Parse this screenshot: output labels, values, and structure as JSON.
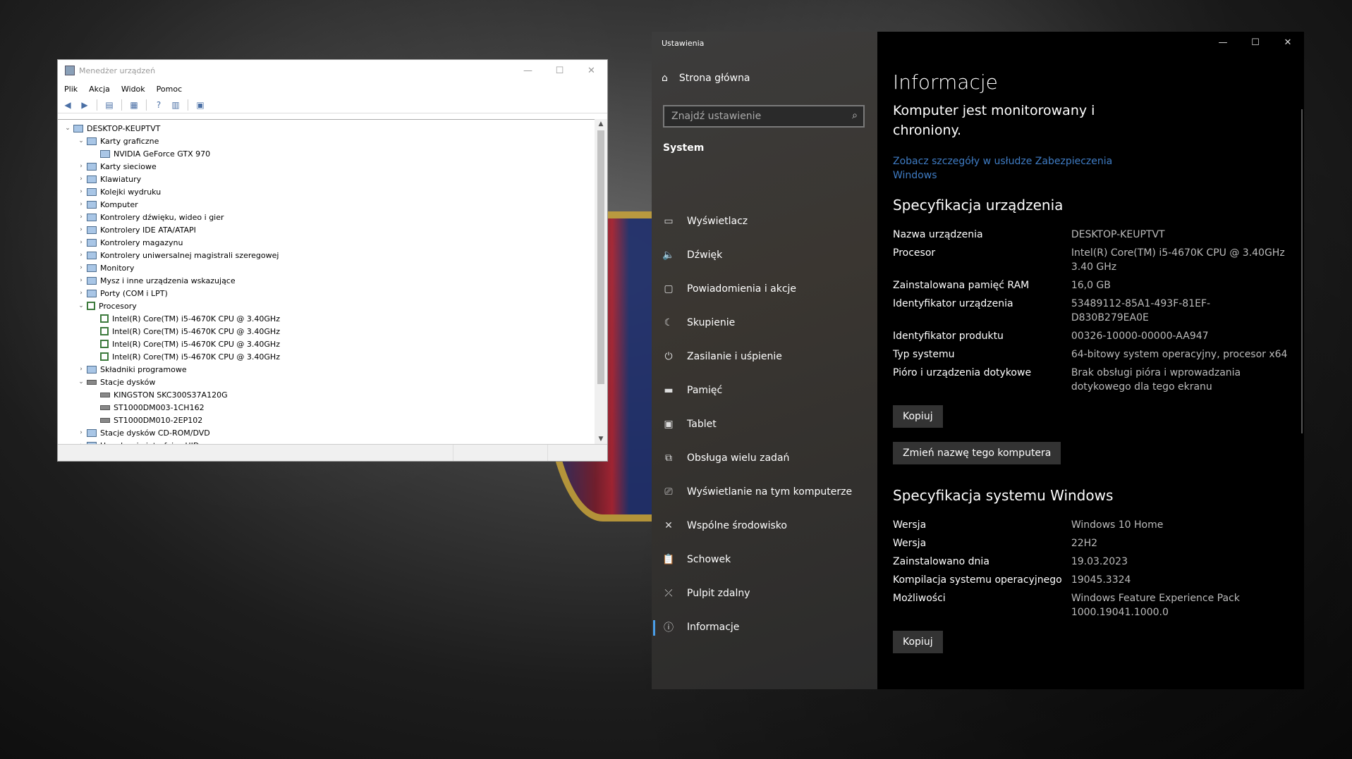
{
  "devmgr": {
    "title": "Menedżer urządzeń",
    "menu": [
      "Plik",
      "Akcja",
      "Widok",
      "Pomoc"
    ],
    "window_buttons": {
      "minimize": "—",
      "maximize": "☐",
      "close": "✕"
    },
    "tree": [
      {
        "arrow": "⌄",
        "text": "DESKTOP-KEUPTVT",
        "level": 0,
        "icon": "computer-icon"
      },
      {
        "arrow": "⌄",
        "text": "Karty graficzne",
        "level": 1,
        "icon": "display-adapter-icon"
      },
      {
        "arrow": "",
        "text": "NVIDIA GeForce GTX 970",
        "level": 2,
        "icon": "display-adapter-icon"
      },
      {
        "arrow": "›",
        "text": "Karty sieciowe",
        "level": 1,
        "icon": "network-adapter-icon"
      },
      {
        "arrow": "›",
        "text": "Klawiatury",
        "level": 1,
        "icon": "keyboard-icon"
      },
      {
        "arrow": "›",
        "text": "Kolejki wydruku",
        "level": 1,
        "icon": "printer-icon"
      },
      {
        "arrow": "›",
        "text": "Komputer",
        "level": 1,
        "icon": "monitor-icon"
      },
      {
        "arrow": "›",
        "text": "Kontrolery dźwięku, wideo i gier",
        "level": 1,
        "icon": "speaker-icon"
      },
      {
        "arrow": "›",
        "text": "Kontrolery IDE ATA/ATAPI",
        "level": 1,
        "icon": "ide-controller-icon"
      },
      {
        "arrow": "›",
        "text": "Kontrolery magazynu",
        "level": 1,
        "icon": "storage-controller-icon"
      },
      {
        "arrow": "›",
        "text": "Kontrolery uniwersalnej magistrali szeregowej",
        "level": 1,
        "icon": "usb-icon"
      },
      {
        "arrow": "›",
        "text": "Monitory",
        "level": 1,
        "icon": "monitor-icon"
      },
      {
        "arrow": "›",
        "text": "Mysz i inne urządzenia wskazujące",
        "level": 1,
        "icon": "mouse-icon"
      },
      {
        "arrow": "›",
        "text": "Porty (COM i LPT)",
        "level": 1,
        "icon": "port-icon"
      },
      {
        "arrow": "⌄",
        "text": "Procesory",
        "level": 1,
        "icon": "cpu-icon"
      },
      {
        "arrow": "",
        "text": "Intel(R) Core(TM) i5-4670K CPU @ 3.40GHz",
        "level": 2,
        "icon": "cpu-icon"
      },
      {
        "arrow": "",
        "text": "Intel(R) Core(TM) i5-4670K CPU @ 3.40GHz",
        "level": 2,
        "icon": "cpu-icon"
      },
      {
        "arrow": "",
        "text": "Intel(R) Core(TM) i5-4670K CPU @ 3.40GHz",
        "level": 2,
        "icon": "cpu-icon"
      },
      {
        "arrow": "",
        "text": "Intel(R) Core(TM) i5-4670K CPU @ 3.40GHz",
        "level": 2,
        "icon": "cpu-icon"
      },
      {
        "arrow": "›",
        "text": "Składniki programowe",
        "level": 1,
        "icon": "software-component-icon"
      },
      {
        "arrow": "⌄",
        "text": "Stacje dysków",
        "level": 1,
        "icon": "disk-icon"
      },
      {
        "arrow": "",
        "text": "KINGSTON SKC300S37A120G",
        "level": 2,
        "icon": "disk-icon"
      },
      {
        "arrow": "",
        "text": "ST1000DM003-1CH162",
        "level": 2,
        "icon": "disk-icon"
      },
      {
        "arrow": "",
        "text": "ST1000DM010-2EP102",
        "level": 2,
        "icon": "disk-icon"
      },
      {
        "arrow": "›",
        "text": "Stacje dysków CD-ROM/DVD",
        "level": 1,
        "icon": "cdrom-icon"
      },
      {
        "arrow": "›",
        "text": "Urządzenia interfejsu HID",
        "level": 1,
        "icon": "hid-icon"
      }
    ]
  },
  "settings": {
    "app_title": "Ustawienia",
    "home_label": "Strona główna",
    "search_placeholder": "Znajdź ustawienie",
    "section_label": "System",
    "nav_items": [
      {
        "label": "Wyświetlacz",
        "icon": "display-icon",
        "glyph": "▭"
      },
      {
        "label": "Dźwięk",
        "icon": "sound-icon",
        "glyph": "🔈"
      },
      {
        "label": "Powiadomienia i akcje",
        "icon": "notifications-icon",
        "glyph": "▢"
      },
      {
        "label": "Skupienie",
        "icon": "focus-moon-icon",
        "glyph": "☾"
      },
      {
        "label": "Zasilanie i uśpienie",
        "icon": "power-icon",
        "glyph": "⏻"
      },
      {
        "label": "Pamięć",
        "icon": "storage-icon",
        "glyph": "▬"
      },
      {
        "label": "Tablet",
        "icon": "tablet-icon",
        "glyph": "▣"
      },
      {
        "label": "Obsługa wielu zadań",
        "icon": "multitasking-icon",
        "glyph": "⧉"
      },
      {
        "label": "Wyświetlanie na tym komputerze",
        "icon": "projecting-icon",
        "glyph": "⎚"
      },
      {
        "label": "Wspólne środowisko",
        "icon": "shared-experiences-icon",
        "glyph": "✕"
      },
      {
        "label": "Schowek",
        "icon": "clipboard-icon",
        "glyph": "📋"
      },
      {
        "label": "Pulpit zdalny",
        "icon": "remote-desktop-icon",
        "glyph": "⤫"
      },
      {
        "label": "Informacje",
        "icon": "info-icon",
        "glyph": "ⓘ",
        "active": true
      }
    ],
    "window_buttons": {
      "minimize": "—",
      "maximize": "☐",
      "close": "✕"
    },
    "page_title": "Informacje",
    "protected_text": "Komputer jest monitorowany i chroniony.",
    "security_link": "Zobacz szczegóły w usłudze Zabezpieczenia Windows",
    "device_spec_title": "Specyfikacja urządzenia",
    "device_spec": [
      {
        "k": "Nazwa urządzenia",
        "v": "DESKTOP-KEUPTVT"
      },
      {
        "k": "Procesor",
        "v": "Intel(R) Core(TM) i5-4670K CPU @ 3.40GHz   3.40 GHz"
      },
      {
        "k": "Zainstalowana pamięć RAM",
        "v": "16,0 GB"
      },
      {
        "k": "Identyfikator urządzenia",
        "v": "53489112-85A1-493F-81EF-D830B279EA0E"
      },
      {
        "k": "Identyfikator produktu",
        "v": "00326-10000-00000-AA947"
      },
      {
        "k": "Typ systemu",
        "v": "64-bitowy system operacyjny, procesor x64"
      },
      {
        "k": "Pióro i urządzenia dotykowe",
        "v": "Brak obsługi pióra i wprowadzania dotykowego dla tego ekranu"
      }
    ],
    "copy_button": "Kopiuj",
    "rename_button": "Zmień nazwę tego komputera",
    "windows_spec_title": "Specyfikacja systemu Windows",
    "windows_spec": [
      {
        "k": "Wersja",
        "v": "Windows 10 Home"
      },
      {
        "k": "Wersja",
        "v": "22H2"
      },
      {
        "k": "Zainstalowano dnia",
        "v": "19.03.2023"
      },
      {
        "k": "Kompilacja systemu operacyjnego",
        "v": "19045.3324"
      },
      {
        "k": "Możliwości",
        "v": "Windows Feature Experience Pack 1000.19041.1000.0"
      }
    ],
    "copy_button_2": "Kopiuj"
  }
}
